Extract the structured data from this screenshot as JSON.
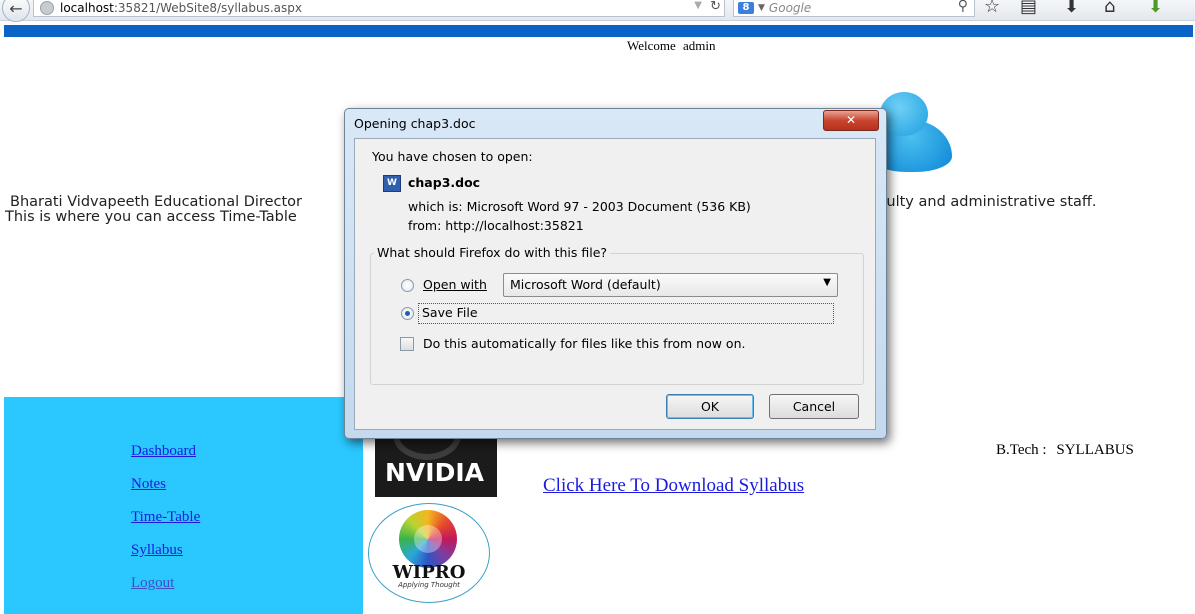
{
  "browser": {
    "url_host": "localhost",
    "url_rest": ":35821/WebSite8/syllabus.aspx",
    "search_engine_label": "8",
    "search_placeholder": "Google"
  },
  "page": {
    "welcome_label": "Welcome",
    "welcome_user": "admin",
    "intro_line1_start": "Bharati Vidvapeeth Educational Director",
    "intro_line1_end": "ts, faculty and administrative staff.",
    "intro_line2_start": "This is where you can access Time-Table",
    "sidebar": {
      "items": [
        {
          "label": "Dashboard"
        },
        {
          "label": "Notes"
        },
        {
          "label": "Time-Table"
        },
        {
          "label": "Syllabus"
        },
        {
          "label": "Logout"
        }
      ]
    },
    "nvidia_logo_text": "NVIDIA",
    "wipro_logo_text": "WIPRO",
    "wipro_tagline": "Applying Thought",
    "download_link": "Click Here To Download Syllabus",
    "course_label": "B.Tech :",
    "course_value": "SYLLABUS"
  },
  "dialog": {
    "title": "Opening chap3.doc",
    "chosen_to_open": "You have chosen to open:",
    "file_name": "chap3.doc",
    "file_type_label": "which is:",
    "file_type": "Microsoft Word 97 - 2003 Document (536 KB)",
    "from_label": "from:",
    "from_value": "http://localhost:35821",
    "question": "What should Firefox do with this file?",
    "open_with_label": "Open with",
    "open_with_app": "Microsoft Word (default)",
    "save_file_label": "Save File",
    "auto_label": "Do this automatically for files like this from now on.",
    "ok_label": "OK",
    "cancel_label": "Cancel",
    "selected_option": "Save File",
    "auto_checked": false
  },
  "colors": {
    "banner": "#0a64c8",
    "sidebar": "#2bc8ff",
    "link": "#1a1ae0"
  }
}
